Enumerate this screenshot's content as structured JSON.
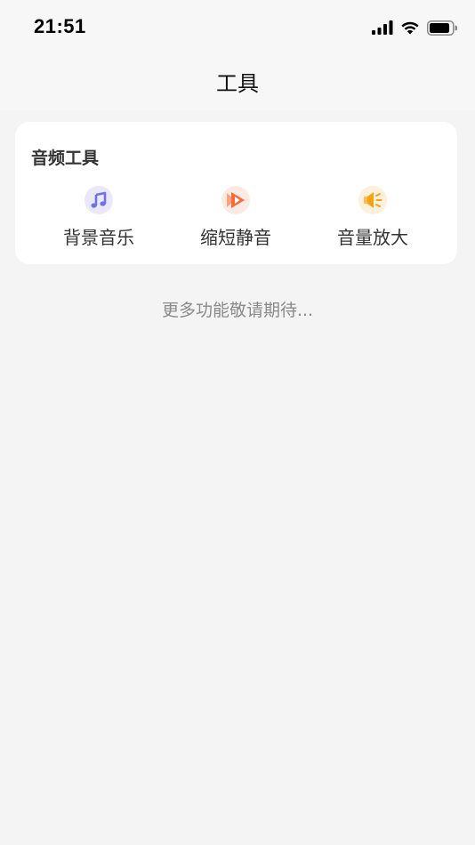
{
  "status_bar": {
    "time": "21:51",
    "icons": [
      "signal-icon",
      "wifi-icon",
      "battery-icon"
    ]
  },
  "nav": {
    "title": "工具"
  },
  "audio_tools": {
    "title": "音频工具",
    "items": [
      {
        "label": "背景音乐",
        "icon": "music-note-icon",
        "icon_color": "#6f72e6",
        "icon_bg": "#e9e9fb"
      },
      {
        "label": "缩短静音",
        "icon": "fast-forward-icon",
        "icon_color": "#f56d3b",
        "icon_bg": "#fdebe3"
      },
      {
        "label": "音量放大",
        "icon": "speaker-icon",
        "icon_color": "#f5a313",
        "icon_bg": "#fdf0dc"
      }
    ]
  },
  "footer": {
    "more_text": "更多功能敬请期待..."
  }
}
